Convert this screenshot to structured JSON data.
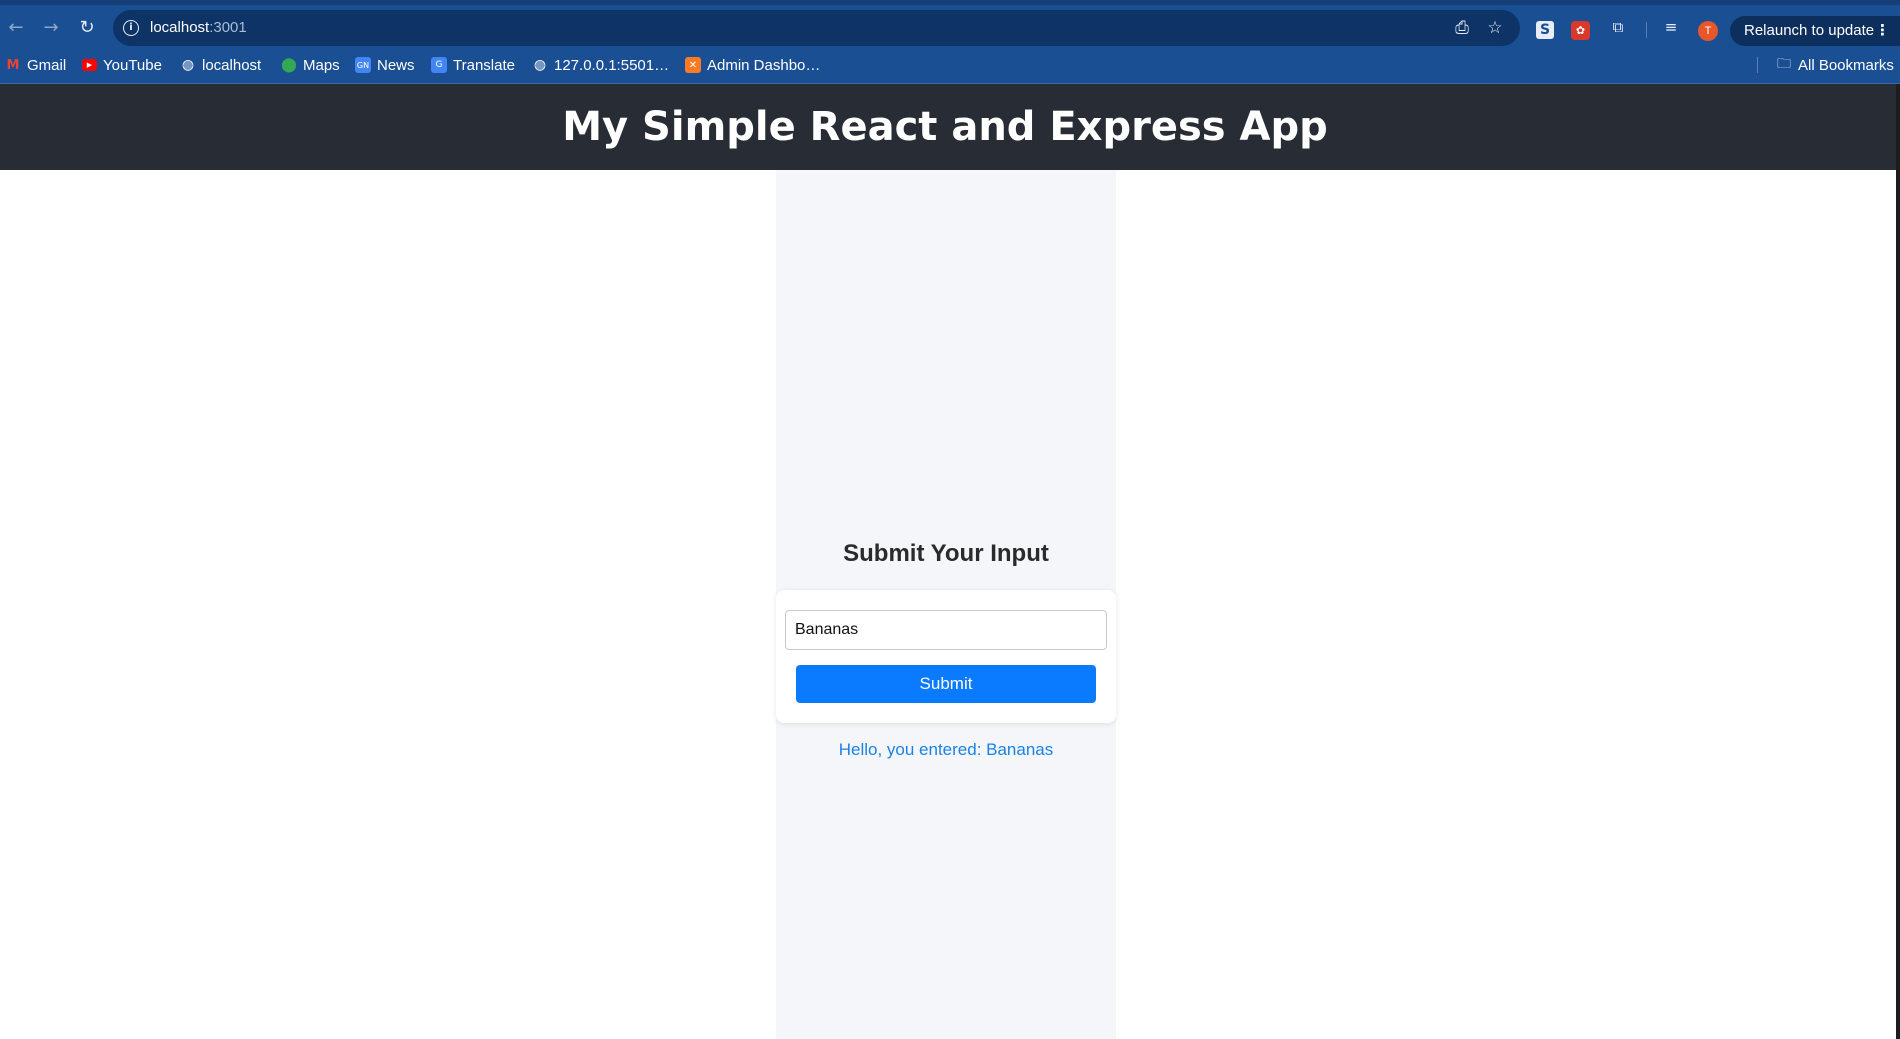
{
  "browser": {
    "url_host": "localhost",
    "url_port": ":3001",
    "relaunch_label": "Relaunch to update",
    "profile_initial": "T",
    "bookmarks": [
      {
        "label": "Gmail",
        "icon": "gmail-icon"
      },
      {
        "label": "YouTube",
        "icon": "youtube-icon"
      },
      {
        "label": "localhost",
        "icon": "globe-icon"
      },
      {
        "label": "Maps",
        "icon": "maps-icon"
      },
      {
        "label": "News",
        "icon": "news-icon"
      },
      {
        "label": "Translate",
        "icon": "translate-icon"
      },
      {
        "label": "127.0.0.1:5501…",
        "icon": "globe-icon"
      },
      {
        "label": "Admin Dashbo…",
        "icon": "xampp-icon"
      }
    ],
    "all_bookmarks_label": "All Bookmarks"
  },
  "app": {
    "header_title": "My Simple React and Express App",
    "form_title": "Submit Your Input",
    "input_value": "Bananas",
    "submit_label": "Submit",
    "result_text": "Hello, you entered: Bananas"
  },
  "colors": {
    "chrome": "#1a4f94",
    "header_bg": "#282c34",
    "submit_bg": "#0a7bff",
    "result_text": "#1a82e6"
  }
}
